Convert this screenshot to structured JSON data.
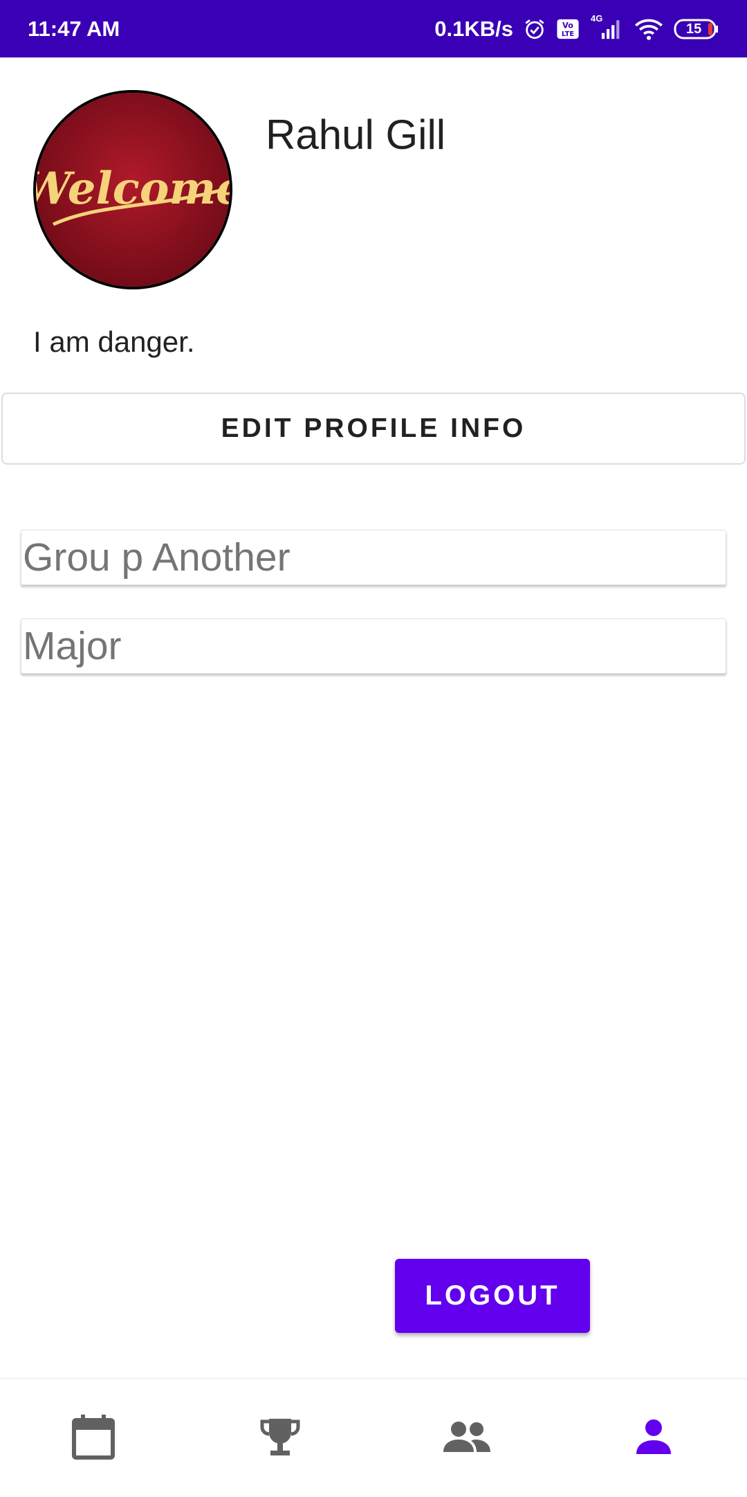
{
  "status_bar": {
    "time": "11:47 AM",
    "network_speed": "0.1KB/s",
    "volte_label": "Vo LTE",
    "network_type": "4G",
    "battery_level": "15"
  },
  "profile": {
    "avatar_text": "Welcome",
    "name": "Rahul Gill",
    "bio": "I am danger."
  },
  "edit_button_label": "EDIT PROFILE INFO",
  "fields": {
    "group_placeholder": "Grou p Another",
    "major_placeholder": "Major"
  },
  "logout_label": "LOGOUT",
  "bottom_nav": {
    "items": [
      {
        "icon": "calendar-icon",
        "active": false
      },
      {
        "icon": "trophy-icon",
        "active": false
      },
      {
        "icon": "group-icon",
        "active": false
      },
      {
        "icon": "person-icon",
        "active": true
      }
    ],
    "active_color": "#6200ee",
    "inactive_color": "#616161"
  },
  "colors": {
    "status_bar": "#3a00b5",
    "accent": "#6200ee"
  }
}
